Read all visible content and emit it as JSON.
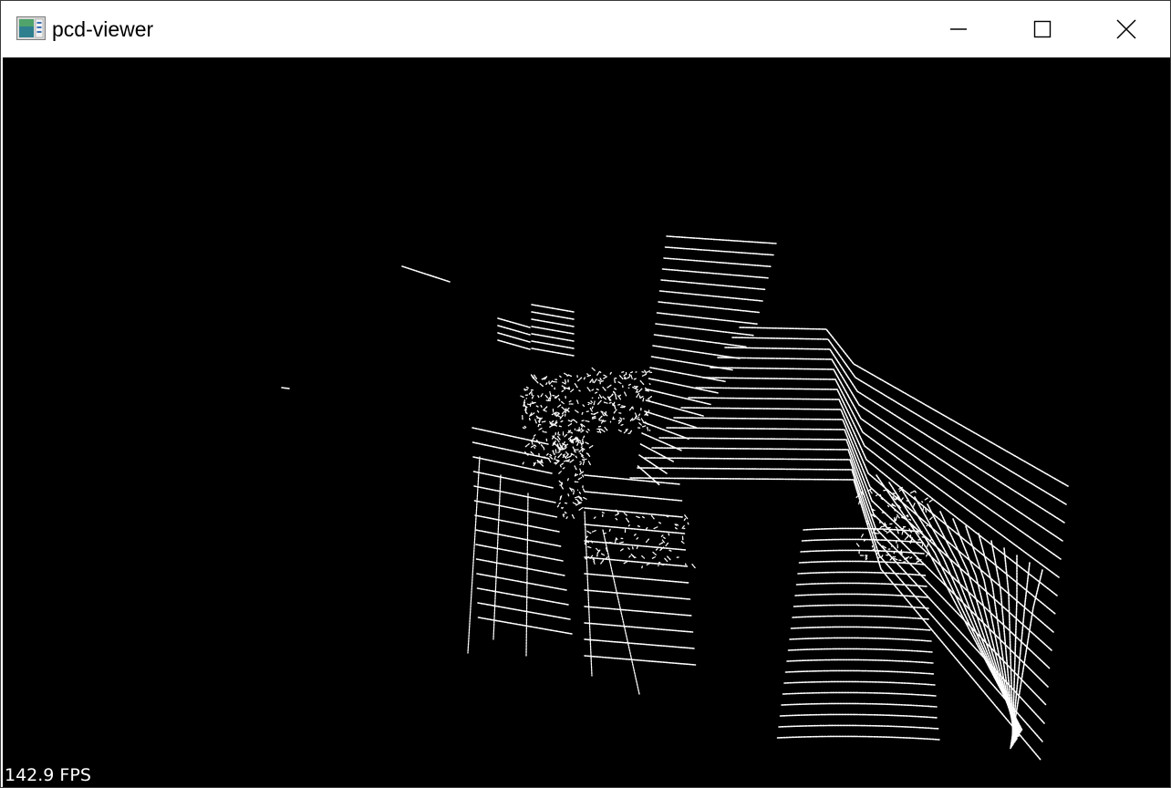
{
  "window": {
    "title": "pcd-viewer",
    "accent_color": "#0078d4"
  },
  "titlebar_buttons": {
    "minimize_icon": "minimize-icon",
    "maximize_icon": "maximize-icon",
    "close_icon": "close-icon"
  },
  "viewport": {
    "background_color": "#000000",
    "point_color": "#ffffff",
    "fps_text": "142.9 FPS"
  }
}
